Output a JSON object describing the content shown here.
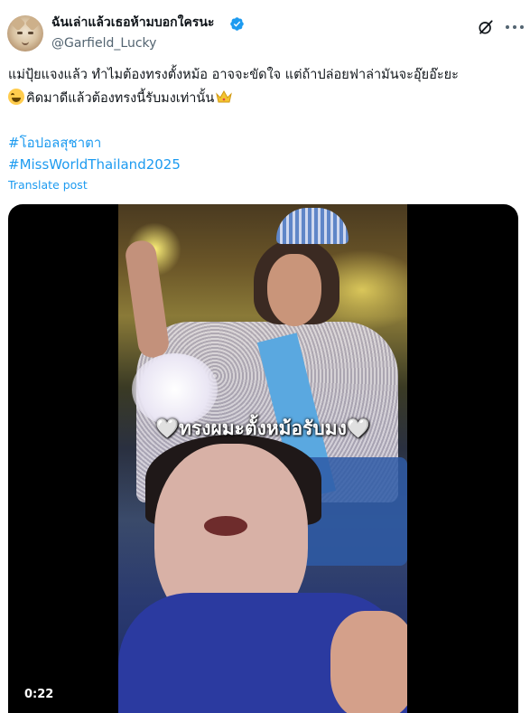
{
  "post": {
    "author": {
      "display_name": "ฉันเล่าแล้วเธอห้ามบอกใครนะ",
      "handle": "@Garfield_Lucky",
      "verified": true,
      "avatar_icon": "cat-avatar"
    },
    "text_lines": [
      "แม่ปุ้ยแจงแล้ว ทำไมต้องทรงตั้งหม้อ อาจจะขัดใจ แต่ถ้าปล่อยฟาล่ามันจะอุ๊ยอ๊ะยะ",
      "คิดมาดีแล้วต้องทรงนี้รับมงเท่านั้น"
    ],
    "hashtags": [
      "#โอปอลสุชาตา",
      "#MissWorldThailand2025"
    ],
    "translate_label": "Translate post",
    "video": {
      "caption": "🤍ทรงผมะตั้งหม้อรับมง🤍",
      "duration": "0:22"
    }
  },
  "colors": {
    "link": "#1d9bf0",
    "secondary_text": "#536471",
    "verified_badge": "#1d9bf0"
  }
}
